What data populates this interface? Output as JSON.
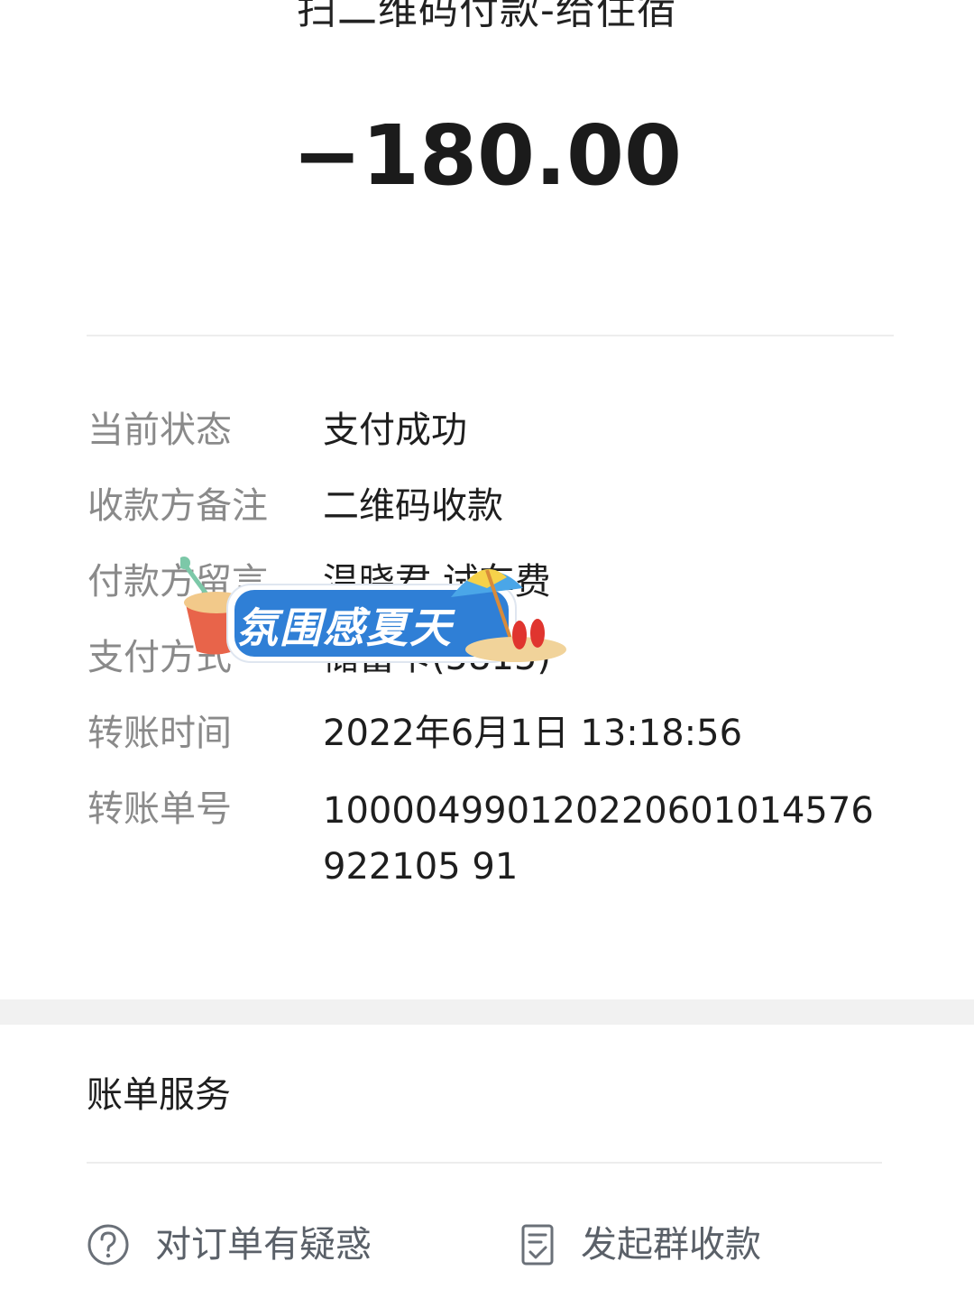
{
  "header": {
    "title": "扫二维码付款-给住宿",
    "amount": "−180.00"
  },
  "details": [
    {
      "label": "当前状态",
      "value": "支付成功"
    },
    {
      "label": "收款方备注",
      "value": "二维码收款"
    },
    {
      "label": "付款方留言",
      "value": "温晓君 试车费"
    },
    {
      "label": "支付方式",
      "value": "储蓄卡(5815)"
    },
    {
      "label": "转账时间",
      "value": "2022年6月1日 13:18:56"
    },
    {
      "label": "转账单号",
      "value": "100004990120220601014576922105 91"
    }
  ],
  "overlay_badge": {
    "text": "氛围感夏天"
  },
  "services": {
    "title": "账单服务",
    "actions": [
      {
        "label": "对订单有疑惑",
        "icon": "question-circle-icon"
      },
      {
        "label": "发起群收款",
        "icon": "checklist-doc-icon"
      }
    ]
  },
  "colors": {
    "label_gray": "#8a8a8a",
    "text_dark": "#1e1e1e",
    "divider": "#ededed",
    "band": "#f1f1f1",
    "icon_stroke": "#6a7078"
  }
}
